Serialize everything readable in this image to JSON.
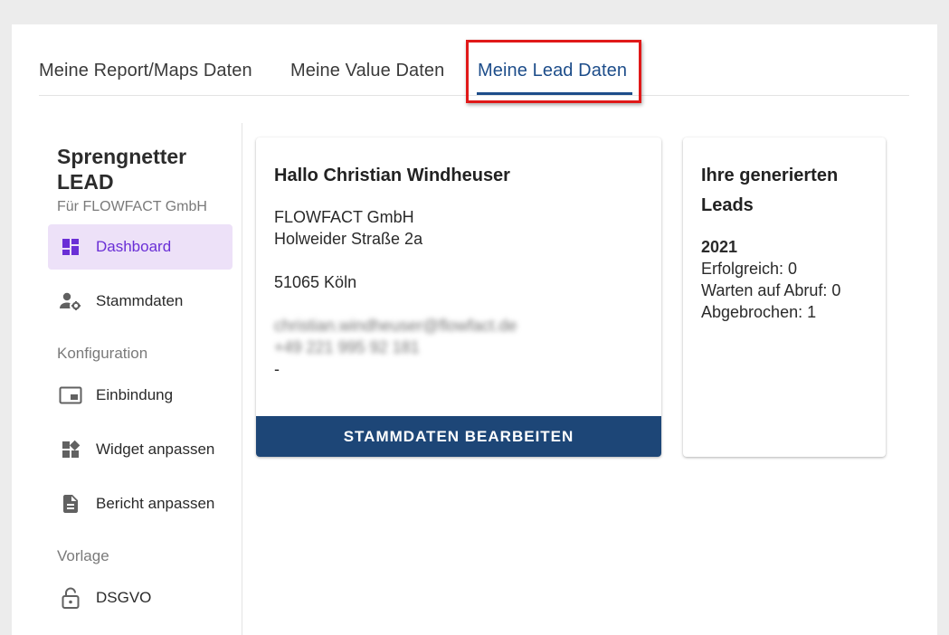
{
  "tabs": [
    {
      "label": "Meine Report/Maps Daten"
    },
    {
      "label": "Meine Value Daten"
    },
    {
      "label": "Meine Lead Daten"
    }
  ],
  "sidebar": {
    "brand_title": "Sprengnetter LEAD",
    "brand_sub": "Für FLOWFACT GmbH",
    "items": [
      {
        "label": "Dashboard",
        "icon": "dashboard-icon"
      },
      {
        "label": "Stammdaten",
        "icon": "user-settings-icon"
      },
      {
        "label": "Einbindung",
        "icon": "embed-icon"
      },
      {
        "label": "Widget anpassen",
        "icon": "widgets-icon"
      },
      {
        "label": "Bericht anpassen",
        "icon": "document-icon"
      },
      {
        "label": "DSGVO",
        "icon": "lock-icon"
      }
    ],
    "sections": [
      {
        "label": "Konfiguration"
      },
      {
        "label": "Vorlage"
      }
    ]
  },
  "profile_card": {
    "greeting": "Hallo Christian Windheuser",
    "company": "FLOWFACT GmbH",
    "street": "Holweider Straße 2a",
    "city": "51065 Köln",
    "email": "christian.windheuser@flowfact.de",
    "phone": "+49 221 995 92 181",
    "extra": "-",
    "button_label": "STAMMDATEN BEARBEITEN"
  },
  "leads_card": {
    "title": "Ihre generierten Leads",
    "year": "2021",
    "successful": "Erfolgreich: 0",
    "waiting": "Warten auf Abruf: 0",
    "cancelled": "Abgebrochen: 1"
  },
  "colors": {
    "accent": "#1d4d8a",
    "active_nav_bg": "#ede1f8",
    "active_nav_text": "#6a2fd6",
    "button_bg": "#1d4677",
    "highlight": "#e01919"
  }
}
